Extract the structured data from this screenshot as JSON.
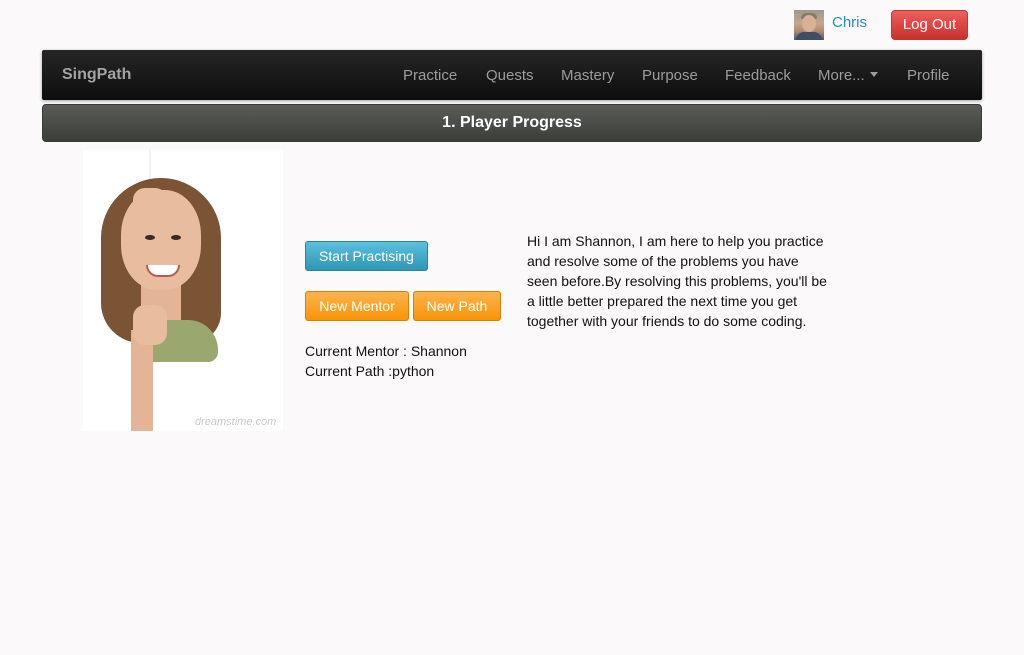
{
  "user": {
    "name": "Chris",
    "logout_label": "Log Out"
  },
  "navbar": {
    "brand": "SingPath",
    "items": [
      {
        "label": "Practice"
      },
      {
        "label": "Quests"
      },
      {
        "label": "Mastery"
      },
      {
        "label": "Purpose"
      },
      {
        "label": "Feedback"
      },
      {
        "label": "More..."
      },
      {
        "label": "Profile"
      }
    ]
  },
  "section": {
    "title": "1. Player Progress"
  },
  "mentor_photo": {
    "watermark": "dreamstime.com"
  },
  "actions": {
    "start_label": "Start Practising",
    "new_mentor_label": "New Mentor",
    "new_path_label": "New Path"
  },
  "status": {
    "mentor_line": "Current Mentor : Shannon",
    "path_line": "Current Path :python"
  },
  "intro_text": "Hi I am Shannon, I am here to help you practice and resolve some of the problems you have seen before.By resolving this problems, you'll be a little better prepared the next time you get together with your friends to do some coding."
}
